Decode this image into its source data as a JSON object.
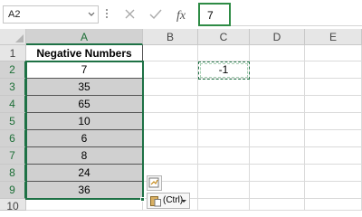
{
  "name_box": {
    "value": "A2"
  },
  "formula_bar": {
    "value": "7"
  },
  "columns": [
    "A",
    "B",
    "C",
    "D",
    "E"
  ],
  "rows": [
    "1",
    "2",
    "3",
    "4",
    "5",
    "6",
    "7",
    "8",
    "9",
    "10"
  ],
  "column_a": {
    "header": "Negative Numbers",
    "values": [
      "7",
      "35",
      "65",
      "10",
      "6",
      "8",
      "24",
      "36"
    ]
  },
  "cell_c2": {
    "value": "-1"
  },
  "paste_options": {
    "label": "(Ctrl)"
  },
  "icons": {
    "name_box_dropdown": "chevron-down-icon",
    "cancel": "x-icon",
    "enter": "check-icon",
    "insert_function": "fx-icon",
    "quick_analysis": "quick-analysis-icon",
    "paste_options": "clipboard-icon"
  },
  "colors": {
    "selection": "#1e7145",
    "selected_cell_fill": "#d0d0d0",
    "header_fill": "#e6e6e6"
  }
}
